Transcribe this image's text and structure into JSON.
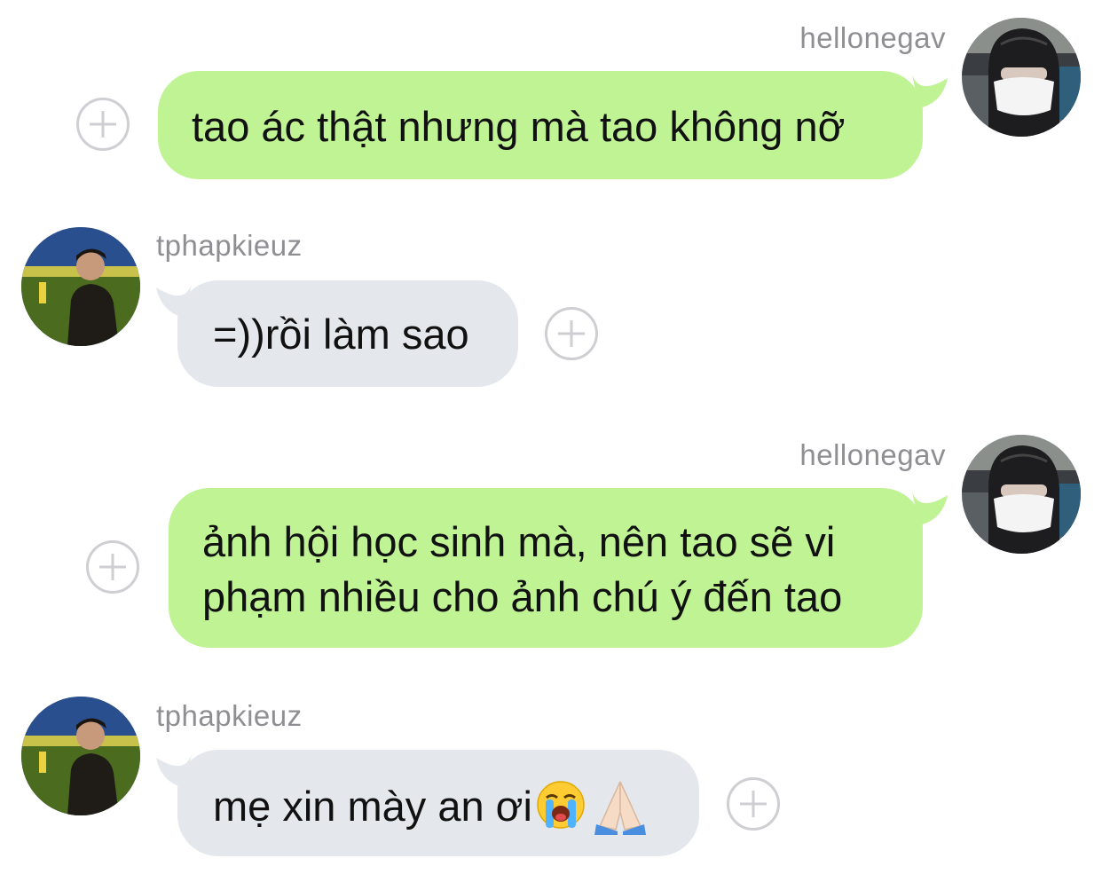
{
  "thread": {
    "messages": [
      {
        "sender": "hellonegav",
        "side": "right",
        "text": "tao ác thật nhưng mà tao không nỡ",
        "avatar_icon": "masked-person-avatar",
        "action_icon": "add-reaction-icon"
      },
      {
        "sender": "tphapkieuz",
        "side": "left",
        "text": "=))rồi làm sao",
        "avatar_icon": "stadium-person-avatar",
        "action_icon": "add-reaction-icon"
      },
      {
        "sender": "hellonegav",
        "side": "right",
        "text": "ảnh hội học sinh mà, nên tao sẽ vi\nphạm nhiều cho ảnh chú ý đến tao",
        "avatar_icon": "masked-person-avatar",
        "action_icon": "add-reaction-icon"
      },
      {
        "sender": "tphapkieuz",
        "side": "left",
        "text": "mẹ xin mày an ơi",
        "emojis": [
          "loudly-crying-face-emoji",
          "folded-hands-emoji"
        ],
        "avatar_icon": "stadium-person-avatar",
        "action_icon": "add-reaction-icon"
      }
    ]
  },
  "colors": {
    "sent_bubble": "#bff394",
    "received_bubble": "#e4e7ec",
    "username": "#8e8e93",
    "plus_icon": "#cfcfd3"
  }
}
